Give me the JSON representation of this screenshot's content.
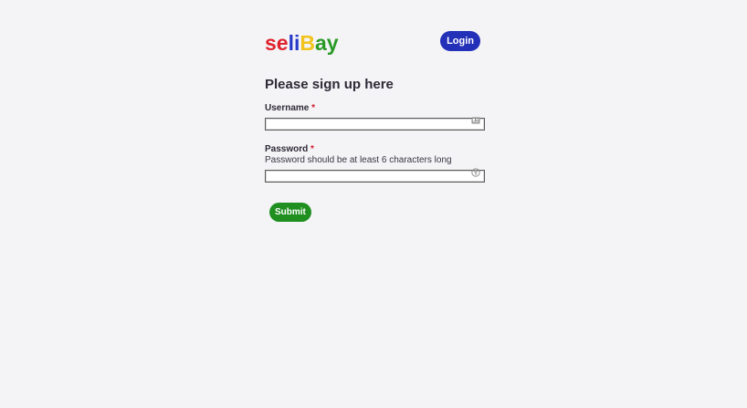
{
  "header": {
    "logo_letters": [
      {
        "char": "s",
        "color": "#e0222c"
      },
      {
        "char": "e",
        "color": "#e0222c"
      },
      {
        "char": "l",
        "color": "#2638c8"
      },
      {
        "char": "i",
        "color": "#2638c8"
      },
      {
        "char": "B",
        "color": "#f2c31a"
      },
      {
        "char": "a",
        "color": "#2a9a26"
      },
      {
        "char": "y",
        "color": "#2a9a26"
      }
    ],
    "login_label": "Login",
    "login_color": "#2330b8"
  },
  "form": {
    "title": "Please sign up here",
    "username": {
      "label": "Username",
      "required_mark": "*",
      "value": "",
      "icon": "contact-card-icon"
    },
    "password": {
      "label": "Password",
      "required_mark": "*",
      "hint": "Password should be at least 6 characters long",
      "value": "",
      "icon": "key-icon"
    },
    "submit_label": "Submit",
    "submit_color": "#1f8f1f"
  }
}
